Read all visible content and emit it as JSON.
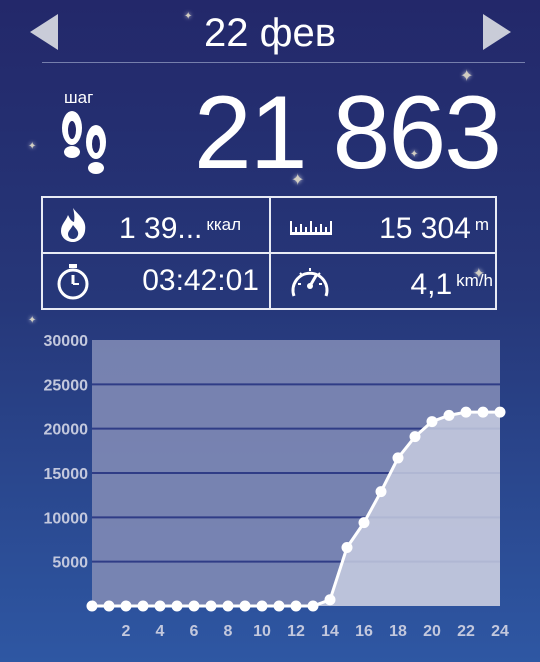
{
  "header": {
    "date": "22 фев",
    "prev_label": "◀",
    "next_label": "▶"
  },
  "steps": {
    "label": "шаг",
    "value": "21 863",
    "icon": "footprints-icon"
  },
  "stats": {
    "calories": {
      "value": "1 39...",
      "unit": "ккал",
      "icon": "flame-icon"
    },
    "distance": {
      "value": "15 304",
      "unit": "m",
      "icon": "ruler-icon"
    },
    "duration": {
      "value": "03:42:01",
      "icon": "stopwatch-icon"
    },
    "speed": {
      "value": "4,1",
      "unit": "km/h",
      "icon": "speedometer-icon"
    }
  },
  "colors": {
    "background_top": "#23286a",
    "background_bottom": "#2e57a3",
    "plot_area": "#7f8ab5",
    "line": "#ffffff",
    "fill": "#c7cde0",
    "gridline": "#2f3c86"
  },
  "chart_data": {
    "type": "area",
    "xlabel": "",
    "ylabel": "",
    "ylim": [
      0,
      30000
    ],
    "xlim": [
      0,
      24
    ],
    "y_ticks": [
      5000,
      10000,
      15000,
      20000,
      25000,
      30000
    ],
    "x_ticks": [
      2,
      4,
      6,
      8,
      10,
      12,
      14,
      16,
      18,
      20,
      22,
      24
    ],
    "grid": true,
    "x": [
      0,
      1,
      2,
      3,
      4,
      5,
      6,
      7,
      8,
      9,
      10,
      11,
      12,
      13,
      14,
      15,
      16,
      17,
      18,
      19,
      20,
      21,
      22,
      23,
      24
    ],
    "values": [
      0,
      0,
      0,
      0,
      0,
      0,
      0,
      0,
      0,
      0,
      0,
      0,
      0,
      0,
      700,
      6600,
      9400,
      12900,
      16700,
      19100,
      20800,
      21500,
      21863,
      21863,
      21863
    ]
  }
}
